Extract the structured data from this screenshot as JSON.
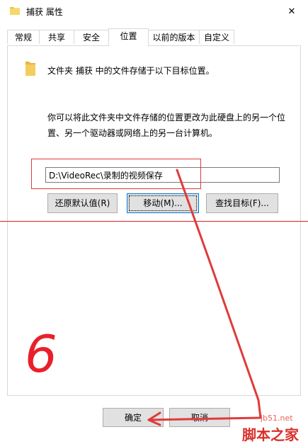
{
  "window": {
    "title": "捕获 属性",
    "close_glyph": "✕"
  },
  "tabs": [
    {
      "label": "常规"
    },
    {
      "label": "共享"
    },
    {
      "label": "安全"
    },
    {
      "label": "位置"
    },
    {
      "label": "以前的版本"
    },
    {
      "label": "自定义"
    }
  ],
  "location": {
    "description": "文件夹 捕获 中的文件存储于以下目标位置。",
    "hint": "你可以将此文件夹中文件存储的位置更改为此硬盘上的另一个位置、另一个驱动器或网络上的另一台计算机。",
    "path": "D:\\VideoRec\\录制的视频保存",
    "restore_button": "还原默认值(R)",
    "move_button": "移动(M)...",
    "find_target_button": "查找目标(F)..."
  },
  "footer": {
    "ok_button": "确定",
    "cancel_button": "取消"
  },
  "annotation": {
    "step_number": "6"
  },
  "watermark": {
    "site": "jb51.net",
    "brand": "脚本之家"
  },
  "colors": {
    "annotation_red": "#e03a3a",
    "folder_yellow": "#f1c232",
    "focus_blue": "#0078d7"
  }
}
